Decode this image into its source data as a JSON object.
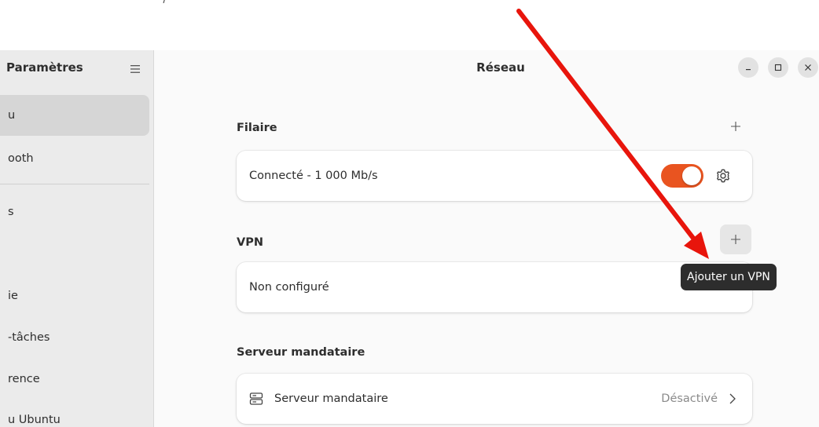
{
  "window": {
    "title": "Réseau"
  },
  "sidebar": {
    "title": "Paramètres",
    "items": [
      {
        "label": "u",
        "selected": true
      },
      {
        "label": "ooth",
        "selected": false
      },
      {
        "label": "s",
        "selected": false
      },
      {
        "label": "",
        "selected": false
      },
      {
        "label": "ie",
        "selected": false
      },
      {
        "label": "-tâches",
        "selected": false
      },
      {
        "label": "rence",
        "selected": false
      },
      {
        "label": "u Ubuntu",
        "selected": false
      }
    ]
  },
  "sections": {
    "wired": {
      "title": "Filaire",
      "status": "Connecté - 1 000 Mb/s",
      "enabled": true
    },
    "vpn": {
      "title": "VPN",
      "status": "Non configuré",
      "tooltip": "Ajouter un VPN"
    },
    "proxy": {
      "title": "Serveur mandataire",
      "label": "Serveur mandataire",
      "status": "Désactivé"
    }
  },
  "icons": {
    "menu": "hamburger-menu-icon",
    "add": "plus-icon",
    "settings": "gear-icon",
    "proxy": "proxy-server-icon",
    "chevron": "chevron-right-icon",
    "minimize": "minimize-icon",
    "maximize": "maximize-icon",
    "close": "close-icon"
  },
  "colors": {
    "accent": "#e95420",
    "annotation_arrow": "#e8150c",
    "tooltip_bg": "#2d2d2d"
  }
}
